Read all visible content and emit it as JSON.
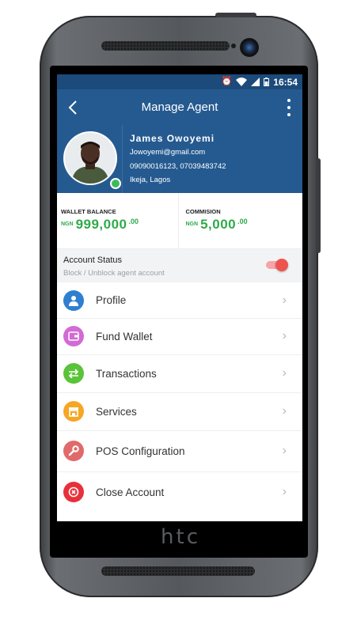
{
  "device": {
    "brand": "htc"
  },
  "status_bar": {
    "time": "16:54",
    "icons": [
      "alarm-icon",
      "wifi-icon",
      "signal-icon",
      "battery-icon"
    ]
  },
  "app_bar": {
    "back_icon": "chevron-left-icon",
    "title": "Manage Agent",
    "menu_icon": "more-vertical-icon"
  },
  "profile": {
    "name": "James Owoyemi",
    "email": "Jowoyemi@gmail.com",
    "phones": "09090016123, 07039483742",
    "location": "Ikeja, Lagos",
    "online": true
  },
  "balances": {
    "wallet": {
      "label": "WALLET BALANCE",
      "currency": "NGN",
      "amount": "999,000",
      "decimals": ".00"
    },
    "commission": {
      "label": "COMMISION",
      "currency": "NGN",
      "amount": "5,000",
      "decimals": ".00"
    }
  },
  "account_status": {
    "title": "Account Status",
    "subtitle": "Block / Unblock agent account",
    "enabled": true
  },
  "menu": [
    {
      "label": "Profile",
      "icon": "user-icon",
      "color": "#2f7fd1"
    },
    {
      "label": "Fund Wallet",
      "icon": "wallet-icon",
      "color": "#d36ad6"
    },
    {
      "label": "Transactions",
      "icon": "transfer-arrows-icon",
      "color": "#59c339"
    },
    {
      "label": "Services",
      "icon": "store-icon",
      "color": "#f5a623"
    },
    {
      "label": "POS Configuration",
      "icon": "wrench-icon",
      "color": "#e06a6a"
    },
    {
      "label": "Close Account",
      "icon": "close-circle-icon",
      "color": "#e8303a"
    }
  ],
  "colors": {
    "primary": "#255a90",
    "status_bar": "#1c4a7a",
    "amount_green": "#2eaa4a",
    "toggle_red": "#ef5350"
  }
}
